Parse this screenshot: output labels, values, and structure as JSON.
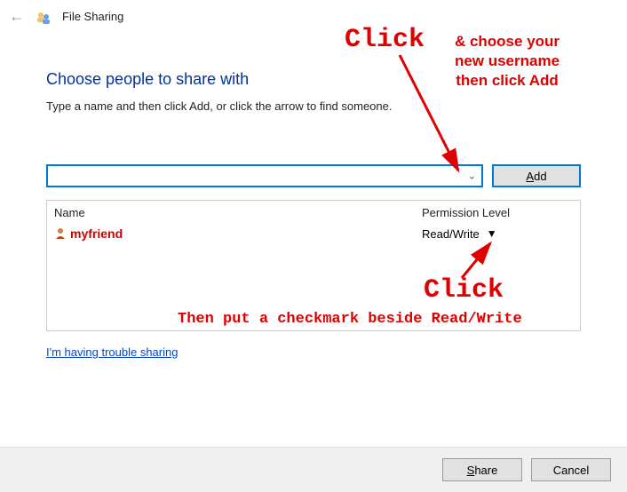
{
  "window": {
    "title": "File Sharing"
  },
  "heading": "Choose people to share with",
  "subtext": "Type a name and then click Add, or click the arrow to find someone.",
  "add_button_prefix": "A",
  "add_button_rest": "dd",
  "list": {
    "col_name": "Name",
    "col_perm": "Permission Level",
    "rows": [
      {
        "name": "myfriend",
        "permission": "Read/Write"
      }
    ]
  },
  "help_link": "I'm having trouble sharing",
  "footer": {
    "share_prefix": "S",
    "share_rest": "hare",
    "cancel": "Cancel"
  },
  "annotations": {
    "click1": "Click",
    "line1": "& choose your",
    "line2": "new username",
    "line3": "then click Add",
    "click2": "Click",
    "line4": "Then put a checkmark beside Read/Write"
  }
}
